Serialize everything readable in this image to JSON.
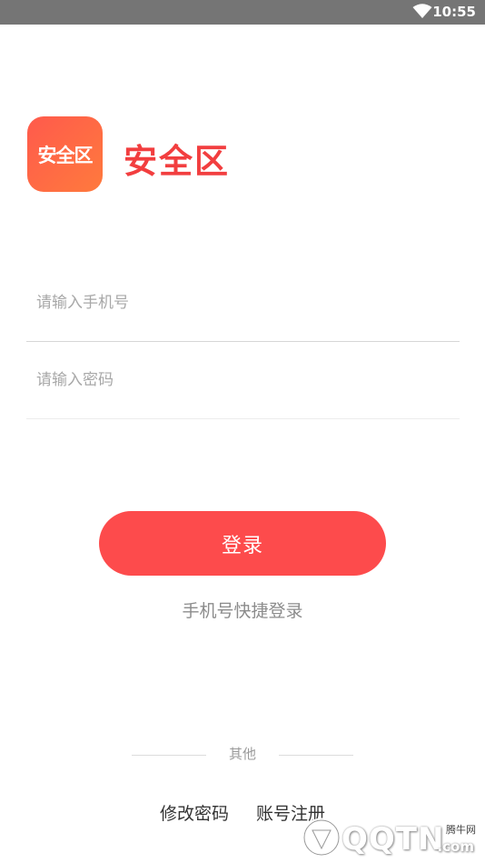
{
  "status_bar": {
    "time": "10:55",
    "wifi_icon": "wifi-icon"
  },
  "brand": {
    "logo_text": "安全区",
    "app_name": "安全区",
    "accent_color": "#fd4b4c"
  },
  "form": {
    "phone_placeholder": "请输入手机号",
    "password_placeholder": "请输入密码",
    "login_label": "登录",
    "quick_login_label": "手机号快捷登录"
  },
  "footer": {
    "other_label": "其他",
    "change_password_label": "修改密码",
    "register_label": "账号注册"
  },
  "watermark": {
    "small": "腾牛网",
    "big": "QQTN",
    "com": ".com"
  }
}
